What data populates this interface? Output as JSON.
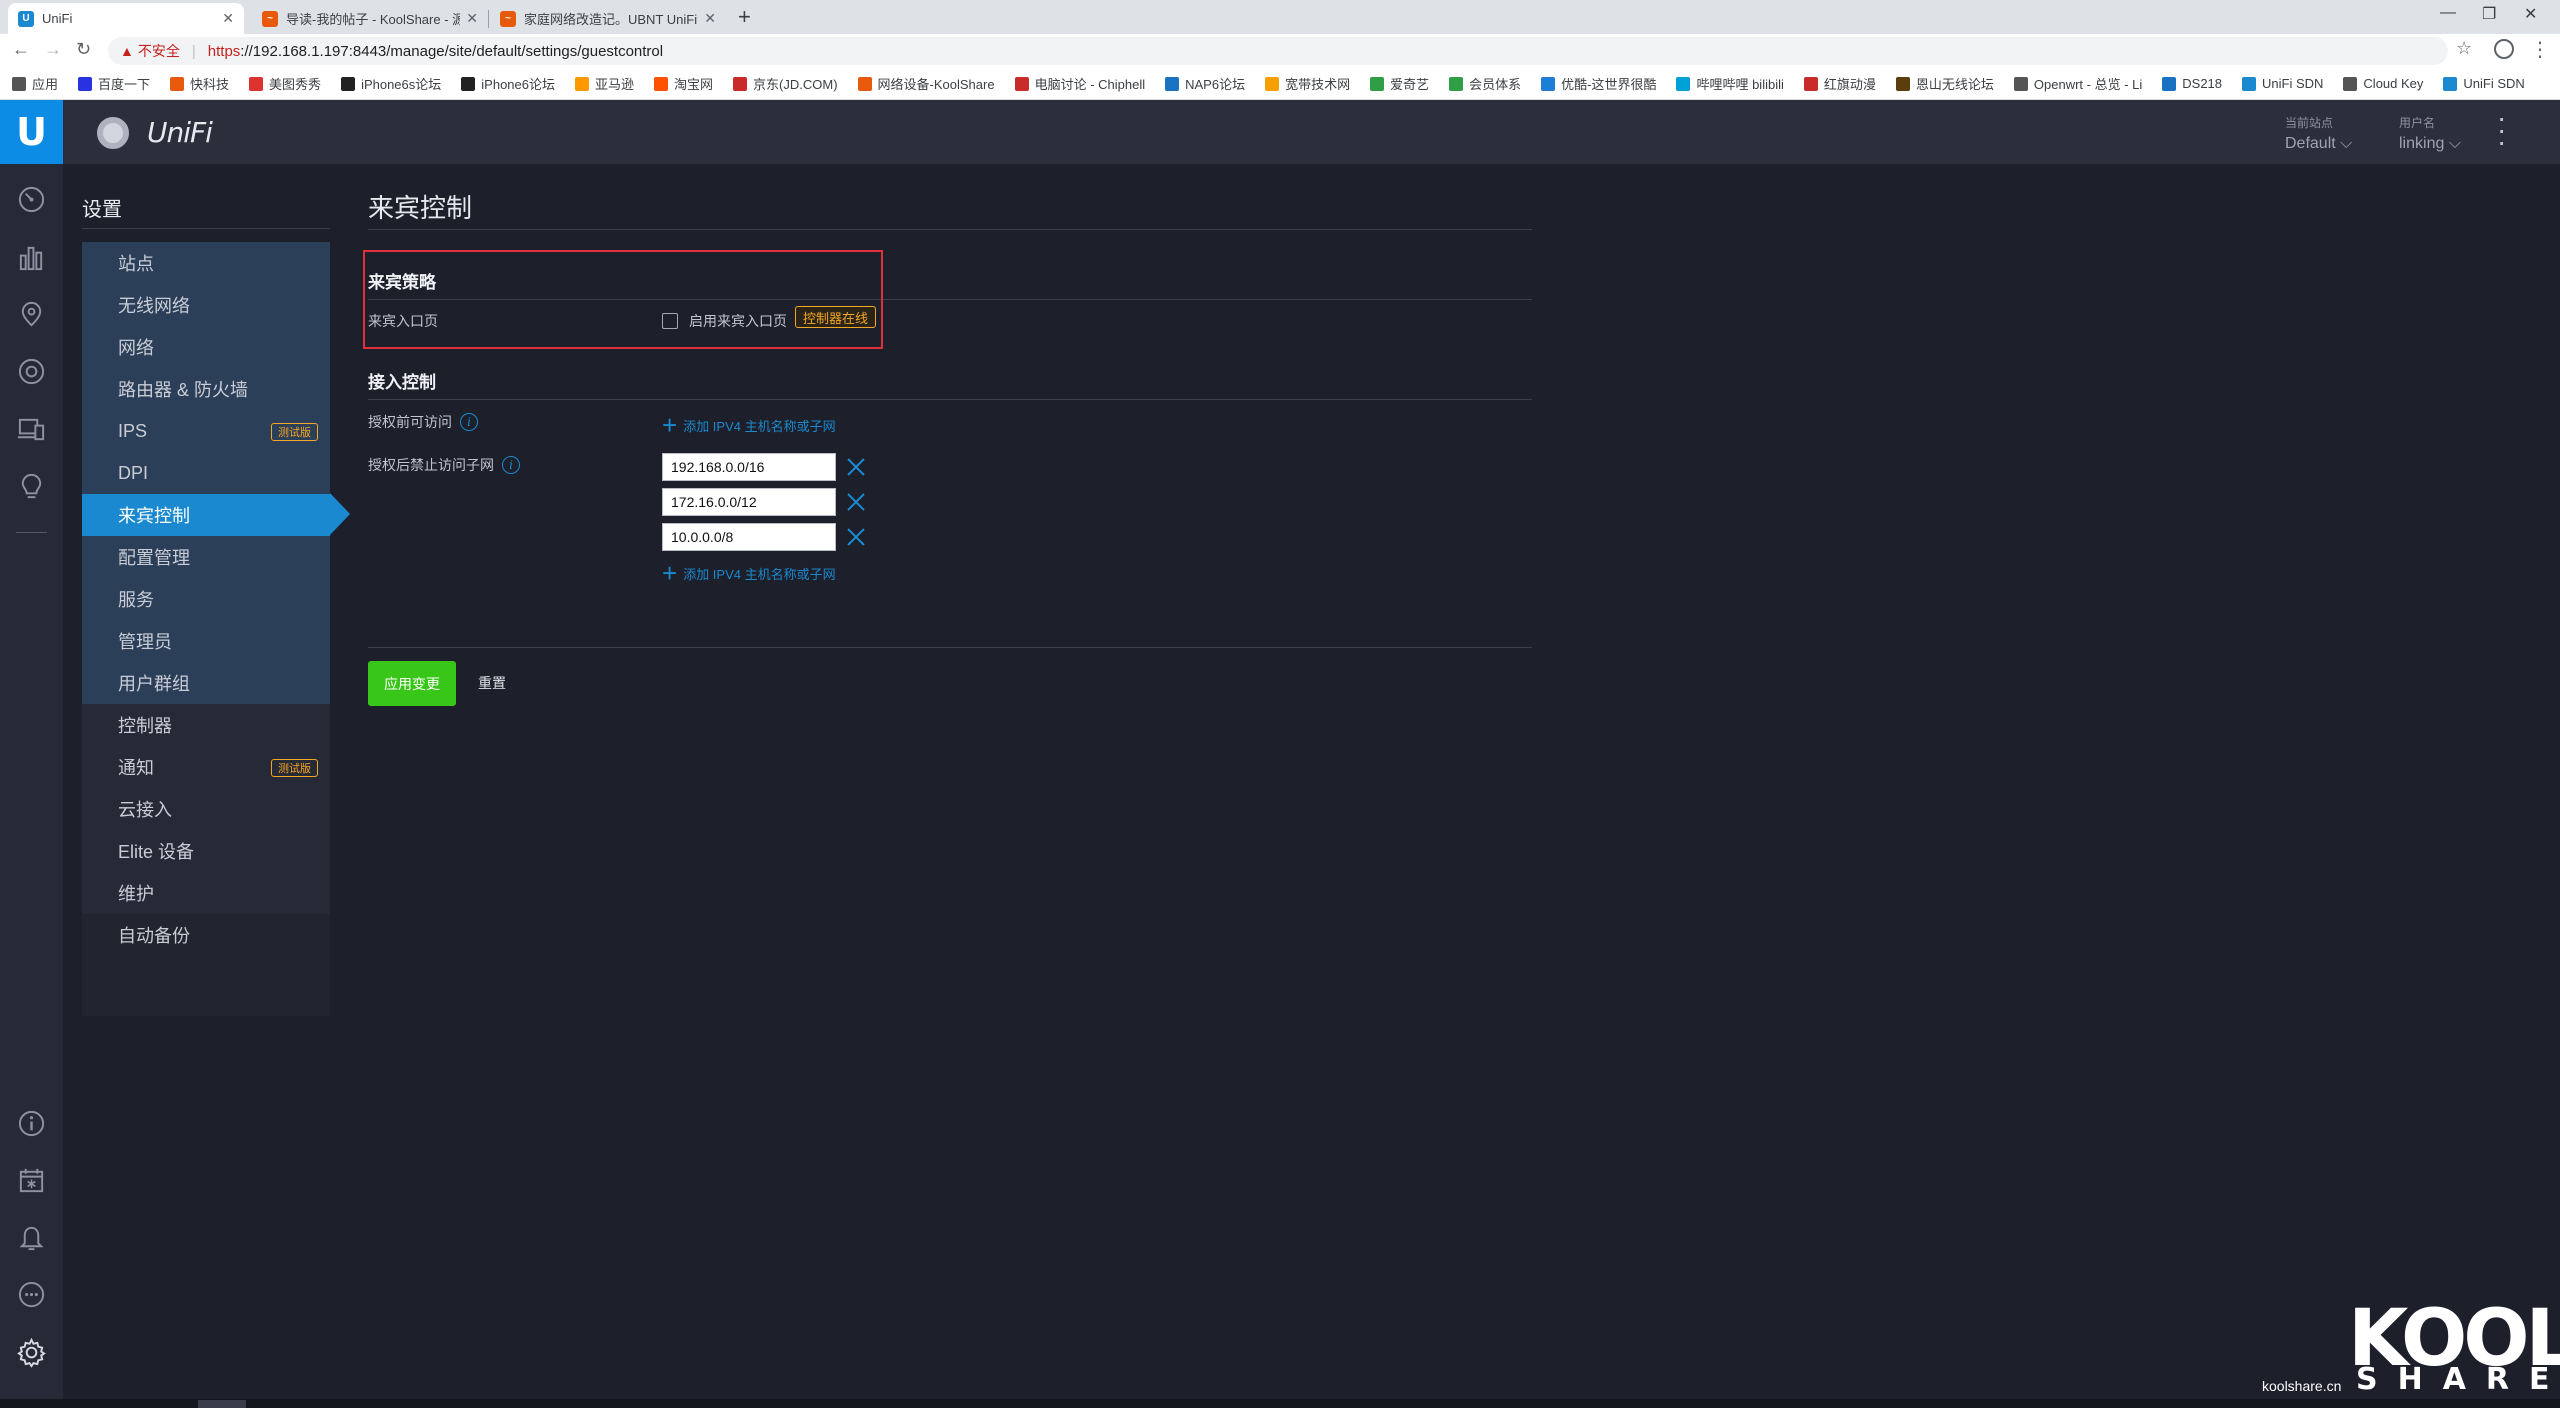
{
  "browser": {
    "tabs": [
      {
        "title": "UniFi",
        "active": true
      },
      {
        "title": "导读-我的帖子 - KoolShare - 源",
        "active": false
      },
      {
        "title": "家庭网络改造记。UBNT UniFi全",
        "active": false
      }
    ],
    "address": {
      "insecure_label": "不安全",
      "scheme": "https",
      "rest": "://192.168.1.197:8443/manage/site/default/settings/guestcontrol"
    },
    "bookmarks": [
      {
        "label": "应用",
        "color": "#555555"
      },
      {
        "label": "百度一下",
        "color": "#2932e1"
      },
      {
        "label": "快科技",
        "color": "#e8590c"
      },
      {
        "label": "美图秀秀",
        "color": "#e03131"
      },
      {
        "label": "iPhone6s论坛",
        "color": "#222222"
      },
      {
        "label": "iPhone6论坛",
        "color": "#222222"
      },
      {
        "label": "亚马逊",
        "color": "#ff9900"
      },
      {
        "label": "淘宝网",
        "color": "#ff5000"
      },
      {
        "label": "京东(JD.COM)",
        "color": "#c92a2a"
      },
      {
        "label": "网络设备-KoolShare",
        "color": "#e8590c"
      },
      {
        "label": "电脑讨论 - Chiphell",
        "color": "#c92a2a"
      },
      {
        "label": "NAP6论坛",
        "color": "#1971c2"
      },
      {
        "label": "宽带技术网",
        "color": "#f59f00"
      },
      {
        "label": "爱奇艺",
        "color": "#2f9e44"
      },
      {
        "label": "会员体系",
        "color": "#2f9e44"
      },
      {
        "label": "优酷-这世界很酷",
        "color": "#1c7ed6"
      },
      {
        "label": "哔哩哔哩 bilibili",
        "color": "#00a1d6"
      },
      {
        "label": "红旗动漫",
        "color": "#c92a2a"
      },
      {
        "label": "恩山无线论坛",
        "color": "#5c3d0e"
      },
      {
        "label": "Openwrt - 总览 - Li",
        "color": "#555555"
      },
      {
        "label": "DS218",
        "color": "#1971c2"
      },
      {
        "label": "UniFi SDN",
        "color": "#1a89cf"
      },
      {
        "label": "Cloud Key",
        "color": "#555555"
      },
      {
        "label": "UniFi SDN",
        "color": "#1a89cf"
      }
    ]
  },
  "app": {
    "brand": "UniFi",
    "site_label": "当前站点",
    "site_value": "Default",
    "user_label": "用户名",
    "user_value": "linking"
  },
  "sidebar": {
    "title": "设置",
    "items": [
      {
        "label": "站点",
        "group": "group1"
      },
      {
        "label": "无线网络",
        "group": "group1"
      },
      {
        "label": "网络",
        "group": "group1"
      },
      {
        "label": "路由器 & 防火墙",
        "group": "group1"
      },
      {
        "label": "IPS",
        "group": "group1",
        "badge": "测试版"
      },
      {
        "label": "DPI",
        "group": "group1"
      },
      {
        "label": "来宾控制",
        "group": "group1",
        "active": true
      },
      {
        "label": "配置管理",
        "group": "group1"
      },
      {
        "label": "服务",
        "group": "group1"
      },
      {
        "label": "管理员",
        "group": "group1"
      },
      {
        "label": "用户群组",
        "group": "group1"
      },
      {
        "label": "控制器",
        "group": "group2"
      },
      {
        "label": "通知",
        "group": "group2",
        "badge": "测试版"
      },
      {
        "label": "云接入",
        "group": "group2"
      },
      {
        "label": "Elite 设备",
        "group": "group2"
      },
      {
        "label": "维护",
        "group": "group2"
      },
      {
        "label": "自动备份",
        "group": "none"
      }
    ]
  },
  "main": {
    "title": "来宾控制",
    "guest_policy": {
      "heading": "来宾策略",
      "portal_label": "来宾入口页",
      "enable_label": "启用来宾入口页",
      "enabled": false,
      "badge": "控制器在线"
    },
    "access_control": {
      "heading": "接入控制",
      "pre_auth_label": "授权前可访问",
      "post_auth_label": "授权后禁止访问子网",
      "add_label": "添加 IPV4 主机名称或子网",
      "subnets": [
        "192.168.0.0/16",
        "172.16.0.0/12",
        "10.0.0.0/8"
      ]
    },
    "apply_label": "应用变更",
    "reset_label": "重置"
  },
  "watermark": {
    "kool": "KOOL",
    "share": "SHARE",
    "domain": "koolshare.cn"
  },
  "colors": {
    "accent": "#1a89cf",
    "apply": "#38c718",
    "badge": "#f5a623",
    "highlight": "#e0313b"
  },
  "icons": {
    "rail": [
      "dashboard-icon",
      "statistics-icon",
      "map-icon",
      "devices-icon",
      "clients-icon",
      "insights-icon",
      "info-icon",
      "events-icon",
      "alerts-icon",
      "chat-icon",
      "settings-icon"
    ]
  }
}
